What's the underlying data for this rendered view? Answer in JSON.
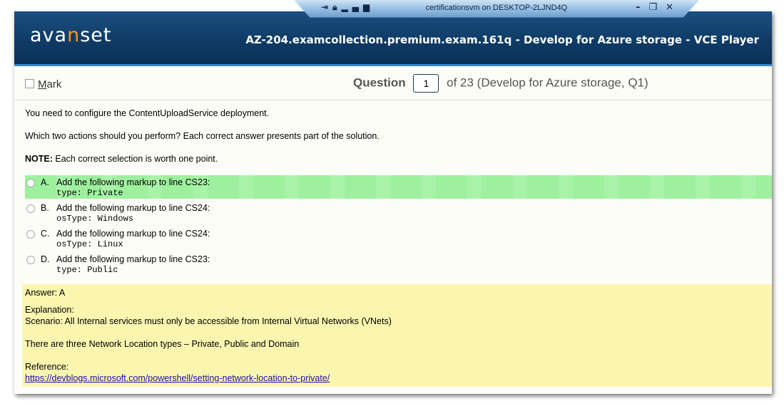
{
  "app": {
    "logo_pre": "ava",
    "logo_n": "n",
    "logo_post": "set",
    "title": "AZ-204.examcollection.premium.exam.161q - Develop for Azure storage - VCE Player"
  },
  "rdp": {
    "title": "certificationsvm on DESKTOP-2LJND4Q",
    "icons": [
      "pin-icon",
      "lock-icon",
      "signal-icon"
    ],
    "controls": [
      "minimize",
      "restore",
      "close"
    ]
  },
  "question_bar": {
    "mark_label_first": "M",
    "mark_label_rest": "ark",
    "question_label": "Question",
    "question_number": "1",
    "of_text": "of 23 (Develop for Azure storage, Q1)"
  },
  "question": {
    "line1": "You need to configure the ContentUploadService deployment.",
    "line2": "Which two actions should you perform? Each correct answer presents part of the solution.",
    "note_label": "NOTE:",
    "note_text": " Each correct selection is worth one point."
  },
  "options": [
    {
      "letter": "A.",
      "text": "Add the following markup to line CS23:",
      "code": "type: Private",
      "selected": true
    },
    {
      "letter": "B.",
      "text": "Add the following markup to line CS24:",
      "code": "osType: Windows",
      "selected": false
    },
    {
      "letter": "C.",
      "text": "Add the following markup to line CS24:",
      "code": "osType: Linux",
      "selected": false
    },
    {
      "letter": "D.",
      "text": "Add the following markup to line CS23:",
      "code": "type: Public",
      "selected": false
    }
  ],
  "answer": {
    "answer_line": "Answer: A",
    "explanation_label": "Explanation:",
    "scenario": "Scenario: All Internal services must only be accessible from Internal Virtual Networks (VNets)",
    "types": "There are three Network Location types – Private, Public and Domain",
    "reference_label": "Reference:",
    "reference_link": "https://devblogs.microsoft.com/powershell/setting-network-location-to-private/"
  },
  "colors": {
    "header": "#0e3a64",
    "header_accent": "#3d84c9",
    "logo_accent": "#f39a1e",
    "selected_option": "#9ef09e",
    "answer_bg": "#faf6b0"
  }
}
